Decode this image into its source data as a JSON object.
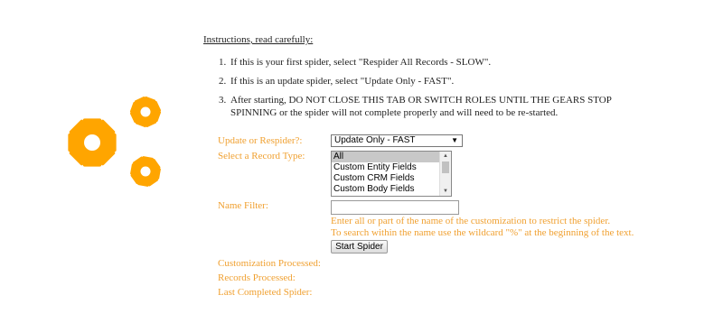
{
  "instructions": {
    "title": "Instructions, read carefully:",
    "steps": [
      {
        "num": "1.",
        "text": "If this is your first spider, select \"Respider All Records - SLOW\"."
      },
      {
        "num": "2.",
        "text": "If this is an update spider, select \"Update Only - FAST\"."
      },
      {
        "num": "3.",
        "text": "After starting, DO NOT CLOSE THIS TAB OR SWITCH ROLES UNTIL THE GEARS STOP SPINNING or the spider will not complete properly and will need to be re-started."
      }
    ]
  },
  "icons": {
    "gears": "gears-icon"
  },
  "colors": {
    "accent": "#f0a030",
    "gear": "#ffa500"
  },
  "form": {
    "update_label": "Update or Respider?:",
    "update_value": "Update Only - FAST",
    "record_type_label": "Select a Record Type:",
    "record_types": [
      "All",
      "Custom Entity Fields",
      "Custom CRM Fields",
      "Custom Body Fields"
    ],
    "record_type_selected": "All",
    "name_filter_label": "Name Filter:",
    "name_filter_value": "",
    "hint_line1": "Enter all or part of the name of the customization to restrict the spider.",
    "hint_line2": "To search within the name use the wildcard \"%\" at the beginning of the text.",
    "start_button": "Start Spider"
  },
  "status": {
    "customization_processed_label": "Customization Processed:",
    "records_processed_label": "Records Processed:",
    "last_completed_label": "Last Completed Spider:"
  }
}
